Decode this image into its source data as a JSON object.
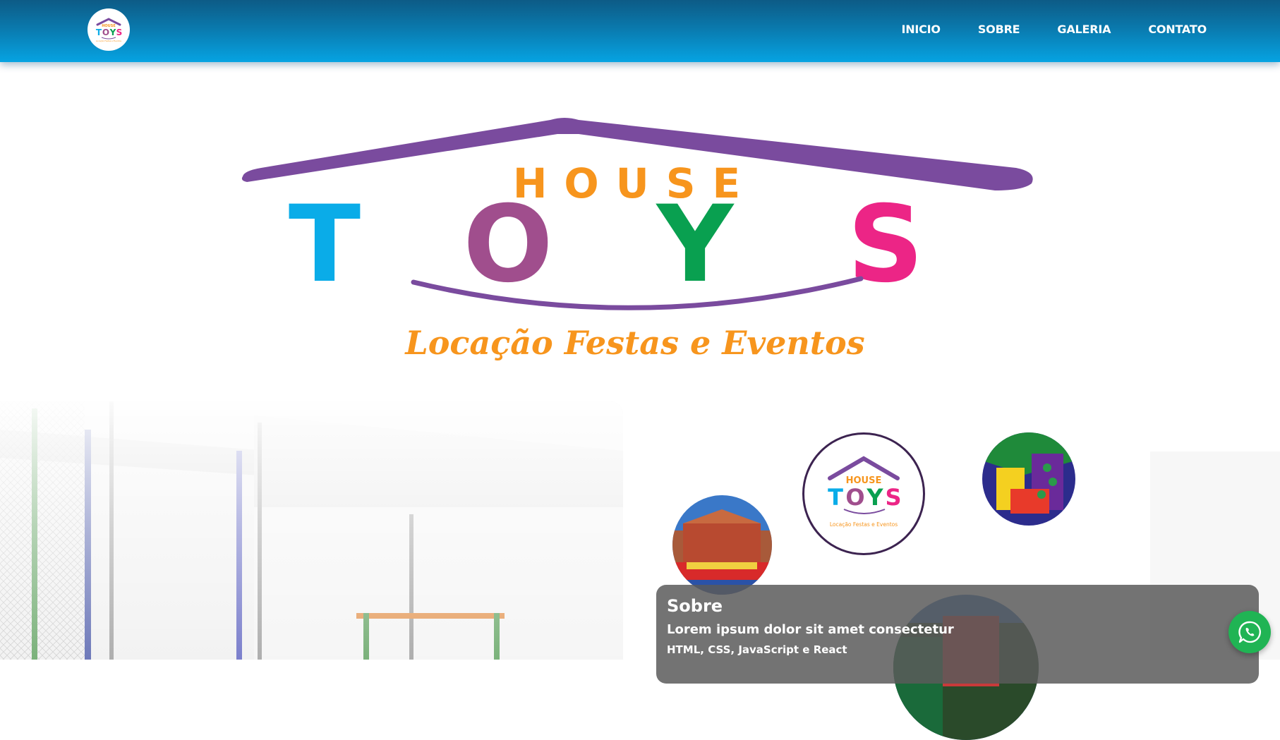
{
  "nav": {
    "items": [
      {
        "label": "INICIO"
      },
      {
        "label": "SOBRE"
      },
      {
        "label": "GALERIA"
      },
      {
        "label": "CONTATO"
      }
    ]
  },
  "brand": {
    "top_word": "HOUSE",
    "letters": [
      "T",
      "O",
      "Y",
      "S"
    ],
    "tagline": "Locação Festas e Eventos",
    "colors": {
      "roof": "#7a4b9e",
      "house": "#f7951d",
      "t": "#0aace8",
      "o": "#a04e8d",
      "y": "#09a050",
      "s": "#ec2586",
      "tagline": "#f7951d"
    }
  },
  "about": {
    "title": "Sobre",
    "subtitle": "Lorem ipsum dolor sit amet consectetur",
    "tech": "HTML, CSS, JavaScript e React"
  },
  "whatsapp": {
    "icon": "whatsapp-icon",
    "color": "#20b454"
  }
}
